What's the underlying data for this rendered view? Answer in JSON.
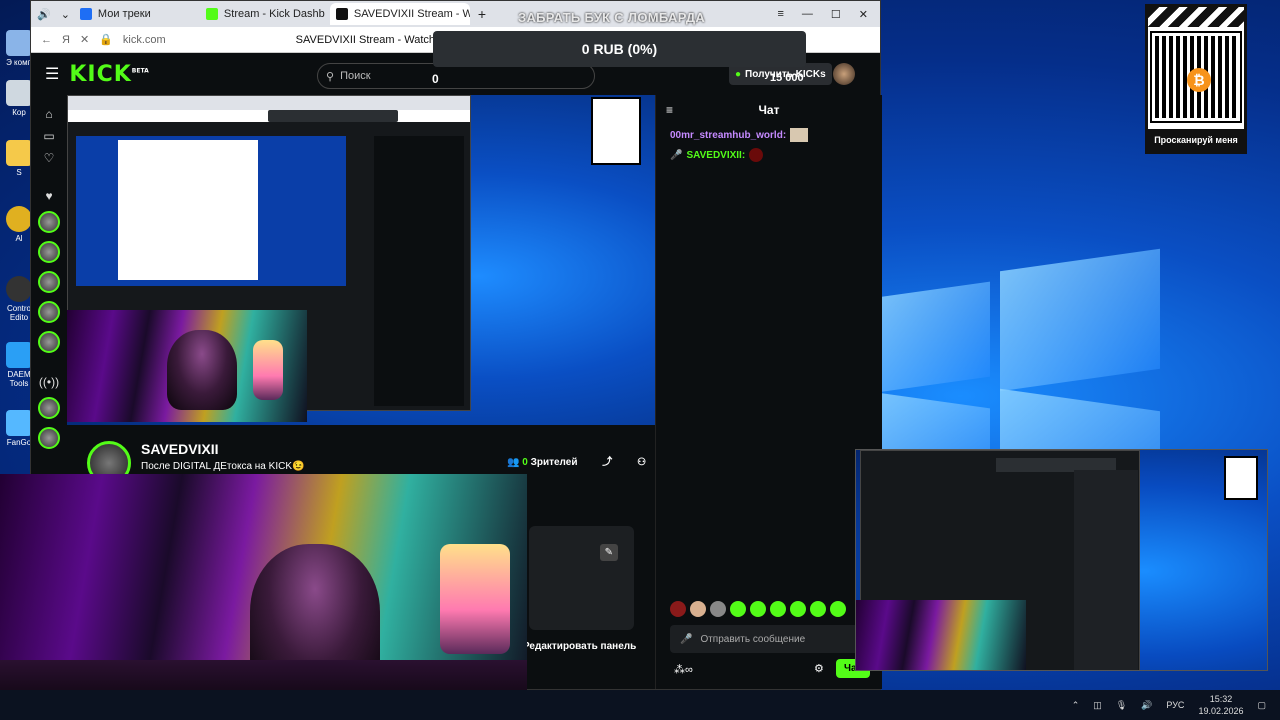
{
  "desktop": {
    "icons": [
      {
        "label": "Э комп"
      },
      {
        "label": "Кор"
      },
      {
        "label": "S"
      },
      {
        "label": "Al"
      },
      {
        "label": "Contro Edito"
      },
      {
        "label": "DAEM Tools"
      },
      {
        "label": "FanGo"
      }
    ],
    "taskbar": {
      "lang": "РУС",
      "time": "15:32",
      "date": "19.02.2026"
    }
  },
  "browser": {
    "tabs": [
      {
        "label": "Мои треки",
        "color": "#1e6ef5"
      },
      {
        "label": "Stream - Kick Dashb",
        "color": "#53fc18"
      },
      {
        "label": "SAVEDVIXII Stream - W",
        "color": "#111111"
      }
    ],
    "address": "kick.com",
    "page_title": "SAVEDVIXII Stream - Watch Live"
  },
  "kick": {
    "logo": "KICK",
    "beta": "BETA",
    "search_placeholder": "Поиск",
    "get_kicks": "Получить KICKs",
    "accent": "#53fc18",
    "streamer": "SAVEDVIXII",
    "stream_title": "После DIGITAL ДЕтокса на KICK😉",
    "viewers_count": "0",
    "viewers_label": "Зрителей",
    "edit_panel": "Редактировать панель",
    "chat": {
      "title": "Чат",
      "messages": [
        {
          "user": "00mr_streamhub_world:",
          "color": "#c58aff"
        },
        {
          "user": "SAVEDVIXII:",
          "color": "#53fc18"
        }
      ],
      "input_placeholder": "Отправить сообщение",
      "send_label": "Чат"
    }
  },
  "overlay": {
    "lombard": "ЗАБРАТЬ БУК С ЛОМБАРДА",
    "rub": "0 RUB (0%)",
    "zero": "0",
    "fifteen": "15 000",
    "qr_label": "Просканируй меня",
    "btc": "₿"
  }
}
